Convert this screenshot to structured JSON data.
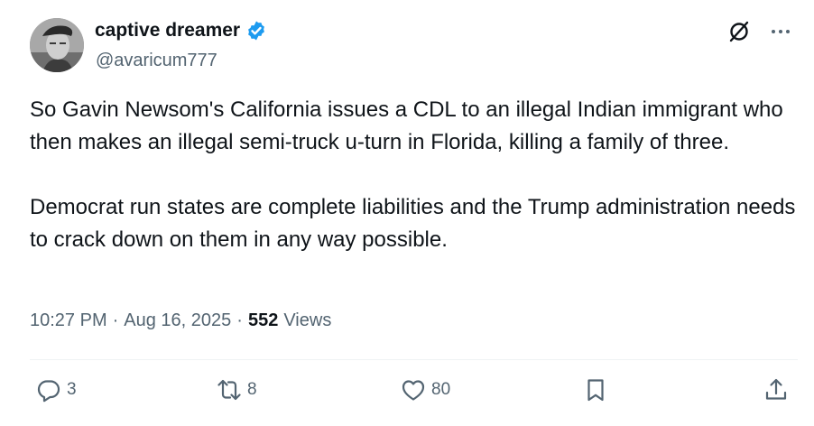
{
  "author": {
    "display_name": "captive dreamer",
    "handle": "@avaricum777",
    "verified": true
  },
  "tweet": {
    "text": "So Gavin Newsom's California issues a CDL to an illegal Indian immigrant who then makes an illegal semi-truck u-turn in Florida, killing a family of three.\n\nDemocrat run states are complete liabilities and the Trump administration needs to crack down on them in any way possible.",
    "time": "10:27 PM",
    "separator_1": "·",
    "date": "Aug 16, 2025",
    "separator_2": "·",
    "views_count": "552",
    "views_label": "Views"
  },
  "actions": {
    "replies": "3",
    "reposts": "8",
    "likes": "80"
  },
  "icons": {
    "verified": "verified-badge-icon",
    "grok": "grok-icon",
    "more": "more-icon",
    "reply": "reply-icon",
    "repost": "repost-icon",
    "like": "heart-icon",
    "bookmark": "bookmark-icon",
    "share": "share-icon"
  },
  "colors": {
    "verified_blue": "#1d9bf0",
    "text_primary": "#0f1419",
    "text_secondary": "#536471"
  }
}
